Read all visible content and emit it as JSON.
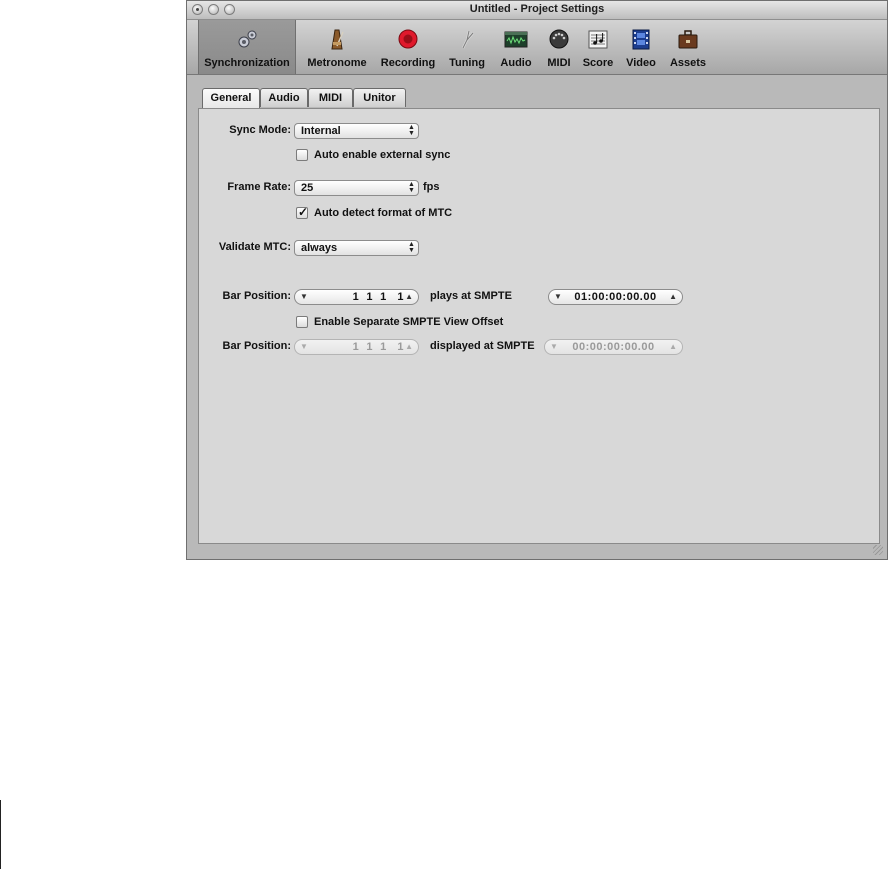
{
  "window": {
    "title": "Untitled - Project Settings"
  },
  "toolbar": {
    "items": [
      {
        "label": "Synchronization",
        "icon": "gears-icon",
        "selected": true
      },
      {
        "label": "Metronome",
        "icon": "metronome-icon"
      },
      {
        "label": "Recording",
        "icon": "record-icon"
      },
      {
        "label": "Tuning",
        "icon": "tuning-fork-icon"
      },
      {
        "label": "Audio",
        "icon": "waveform-icon"
      },
      {
        "label": "MIDI",
        "icon": "midi-connector-icon"
      },
      {
        "label": "Score",
        "icon": "score-notes-icon"
      },
      {
        "label": "Video",
        "icon": "film-icon"
      },
      {
        "label": "Assets",
        "icon": "briefcase-icon"
      }
    ]
  },
  "tabs": [
    "General",
    "Audio",
    "MIDI",
    "Unitor"
  ],
  "active_tab": "General",
  "form": {
    "sync_mode_label": "Sync Mode:",
    "sync_mode_value": "Internal",
    "auto_enable_label": "Auto enable external sync",
    "auto_enable_checked": false,
    "frame_rate_label": "Frame Rate:",
    "frame_rate_value": "25",
    "fps_label": "fps",
    "auto_detect_label": "Auto detect format of MTC",
    "auto_detect_checked": true,
    "validate_label": "Validate MTC:",
    "validate_value": "always",
    "bar_position_label": "Bar Position:",
    "bar_position_value": "1  1  1   1",
    "plays_label": "plays at SMPTE",
    "smpte_value": "01:00:00:00.00",
    "enable_offset_label": "Enable Separate SMPTE View Offset",
    "enable_offset_checked": false,
    "bar_position2_label": "Bar Position:",
    "bar_position2_value": "1  1  1   1",
    "displayed_label": "displayed at SMPTE",
    "smpte2_value": "00:00:00:00.00"
  },
  "colors": {
    "record_red": "#e0192c",
    "chrome": "#b9b9b9",
    "panel": "#d8d8d8"
  }
}
